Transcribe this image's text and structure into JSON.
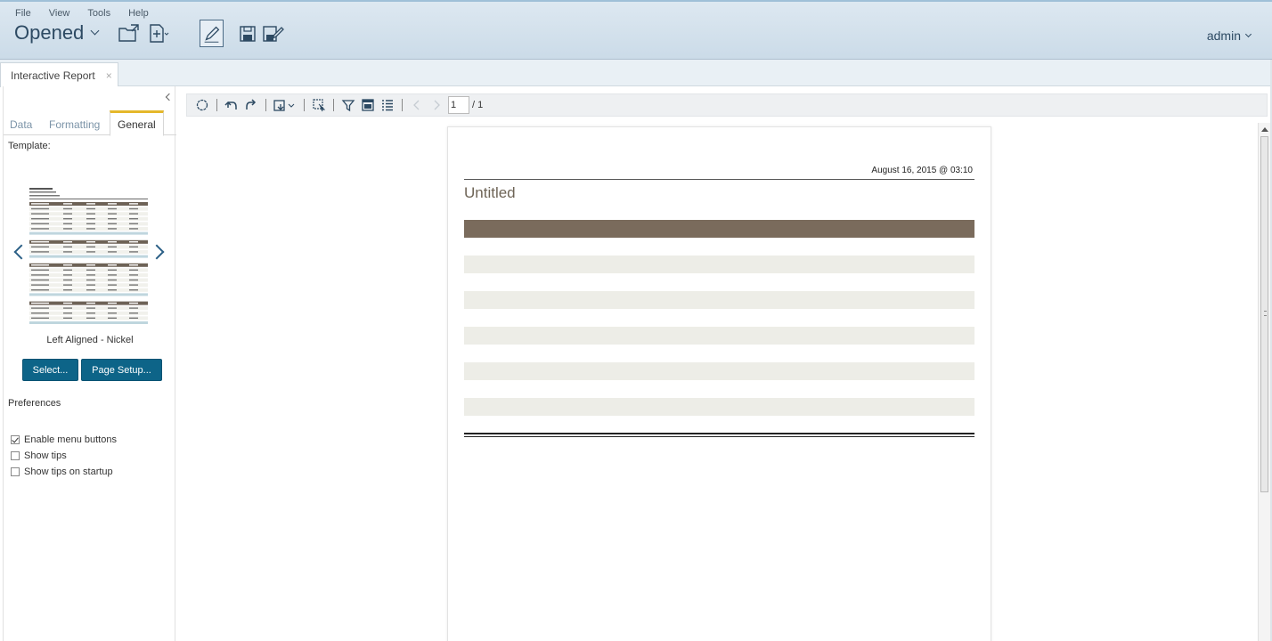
{
  "menu": {
    "file": "File",
    "view": "View",
    "tools": "Tools",
    "help": "Help"
  },
  "perspective": {
    "label": "Opened"
  },
  "user": {
    "name": "admin"
  },
  "document_tab": {
    "label": "Interactive Report",
    "close": "×"
  },
  "panel_tabs": {
    "data": "Data",
    "formatting": "Formatting",
    "general": "General"
  },
  "general": {
    "template_label": "Template:",
    "template_name": "Left Aligned - Nickel",
    "select_button": "Select...",
    "page_setup_button": "Page Setup...",
    "preferences_label": "Preferences",
    "preferences": [
      {
        "label": "Enable menu buttons",
        "checked": true
      },
      {
        "label": "Show tips",
        "checked": false
      },
      {
        "label": "Show tips on startup",
        "checked": false
      }
    ]
  },
  "pager": {
    "current": "1",
    "total": "/ 1"
  },
  "report": {
    "date": "August 16, 2015 @ 03:10",
    "title": "Untitled"
  },
  "colors": {
    "accent": "#e5b82b",
    "button": "#0d6488",
    "report_header": "#7a6b5c",
    "report_alt_row": "#edede7"
  }
}
